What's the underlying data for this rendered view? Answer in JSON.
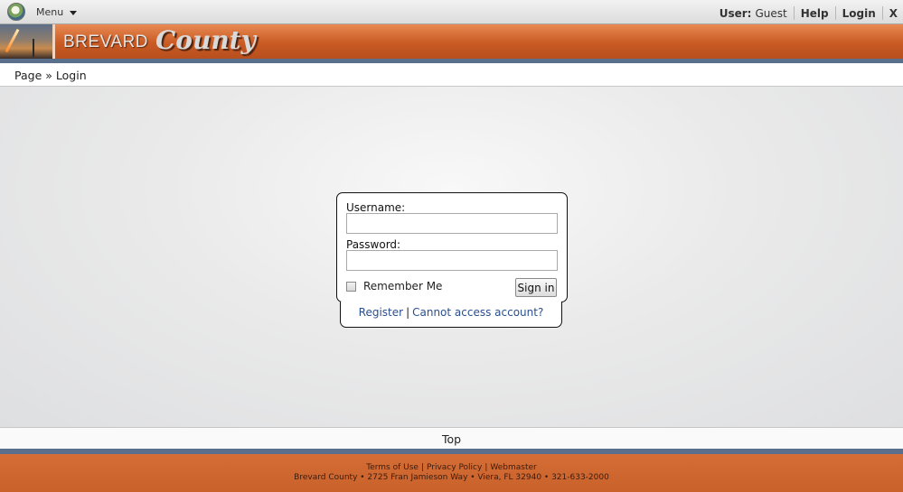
{
  "topbar": {
    "menu_label": "Menu",
    "user_label": "User:",
    "user_name": "Guest",
    "help_label": "Help",
    "login_label": "Login",
    "close_label": "X"
  },
  "banner": {
    "title": "BREVARD",
    "script_title": "County"
  },
  "breadcrumb": {
    "page": "Page",
    "separator": "»",
    "current": "Login"
  },
  "login": {
    "username_label": "Username:",
    "username_value": "",
    "password_label": "Password:",
    "password_value": "",
    "remember_label": "Remember Me",
    "remember_checked": false,
    "signin_label": "Sign in",
    "register_label": "Register",
    "links_separator": "|",
    "cannot_access_label": "Cannot access account?"
  },
  "top_link": "Top",
  "footer": {
    "terms": "Terms of Use",
    "privacy": "Privacy Policy",
    "webmaster": "Webmaster",
    "separator": "|",
    "address": "Brevard County • 2725 Fran Jamieson Way • Viera, FL 32940 • 321-633-2000"
  },
  "colors": {
    "banner_orange": "#c95a24",
    "stripe_blue": "#5a6f8c",
    "link_blue": "#2a4f8f"
  }
}
